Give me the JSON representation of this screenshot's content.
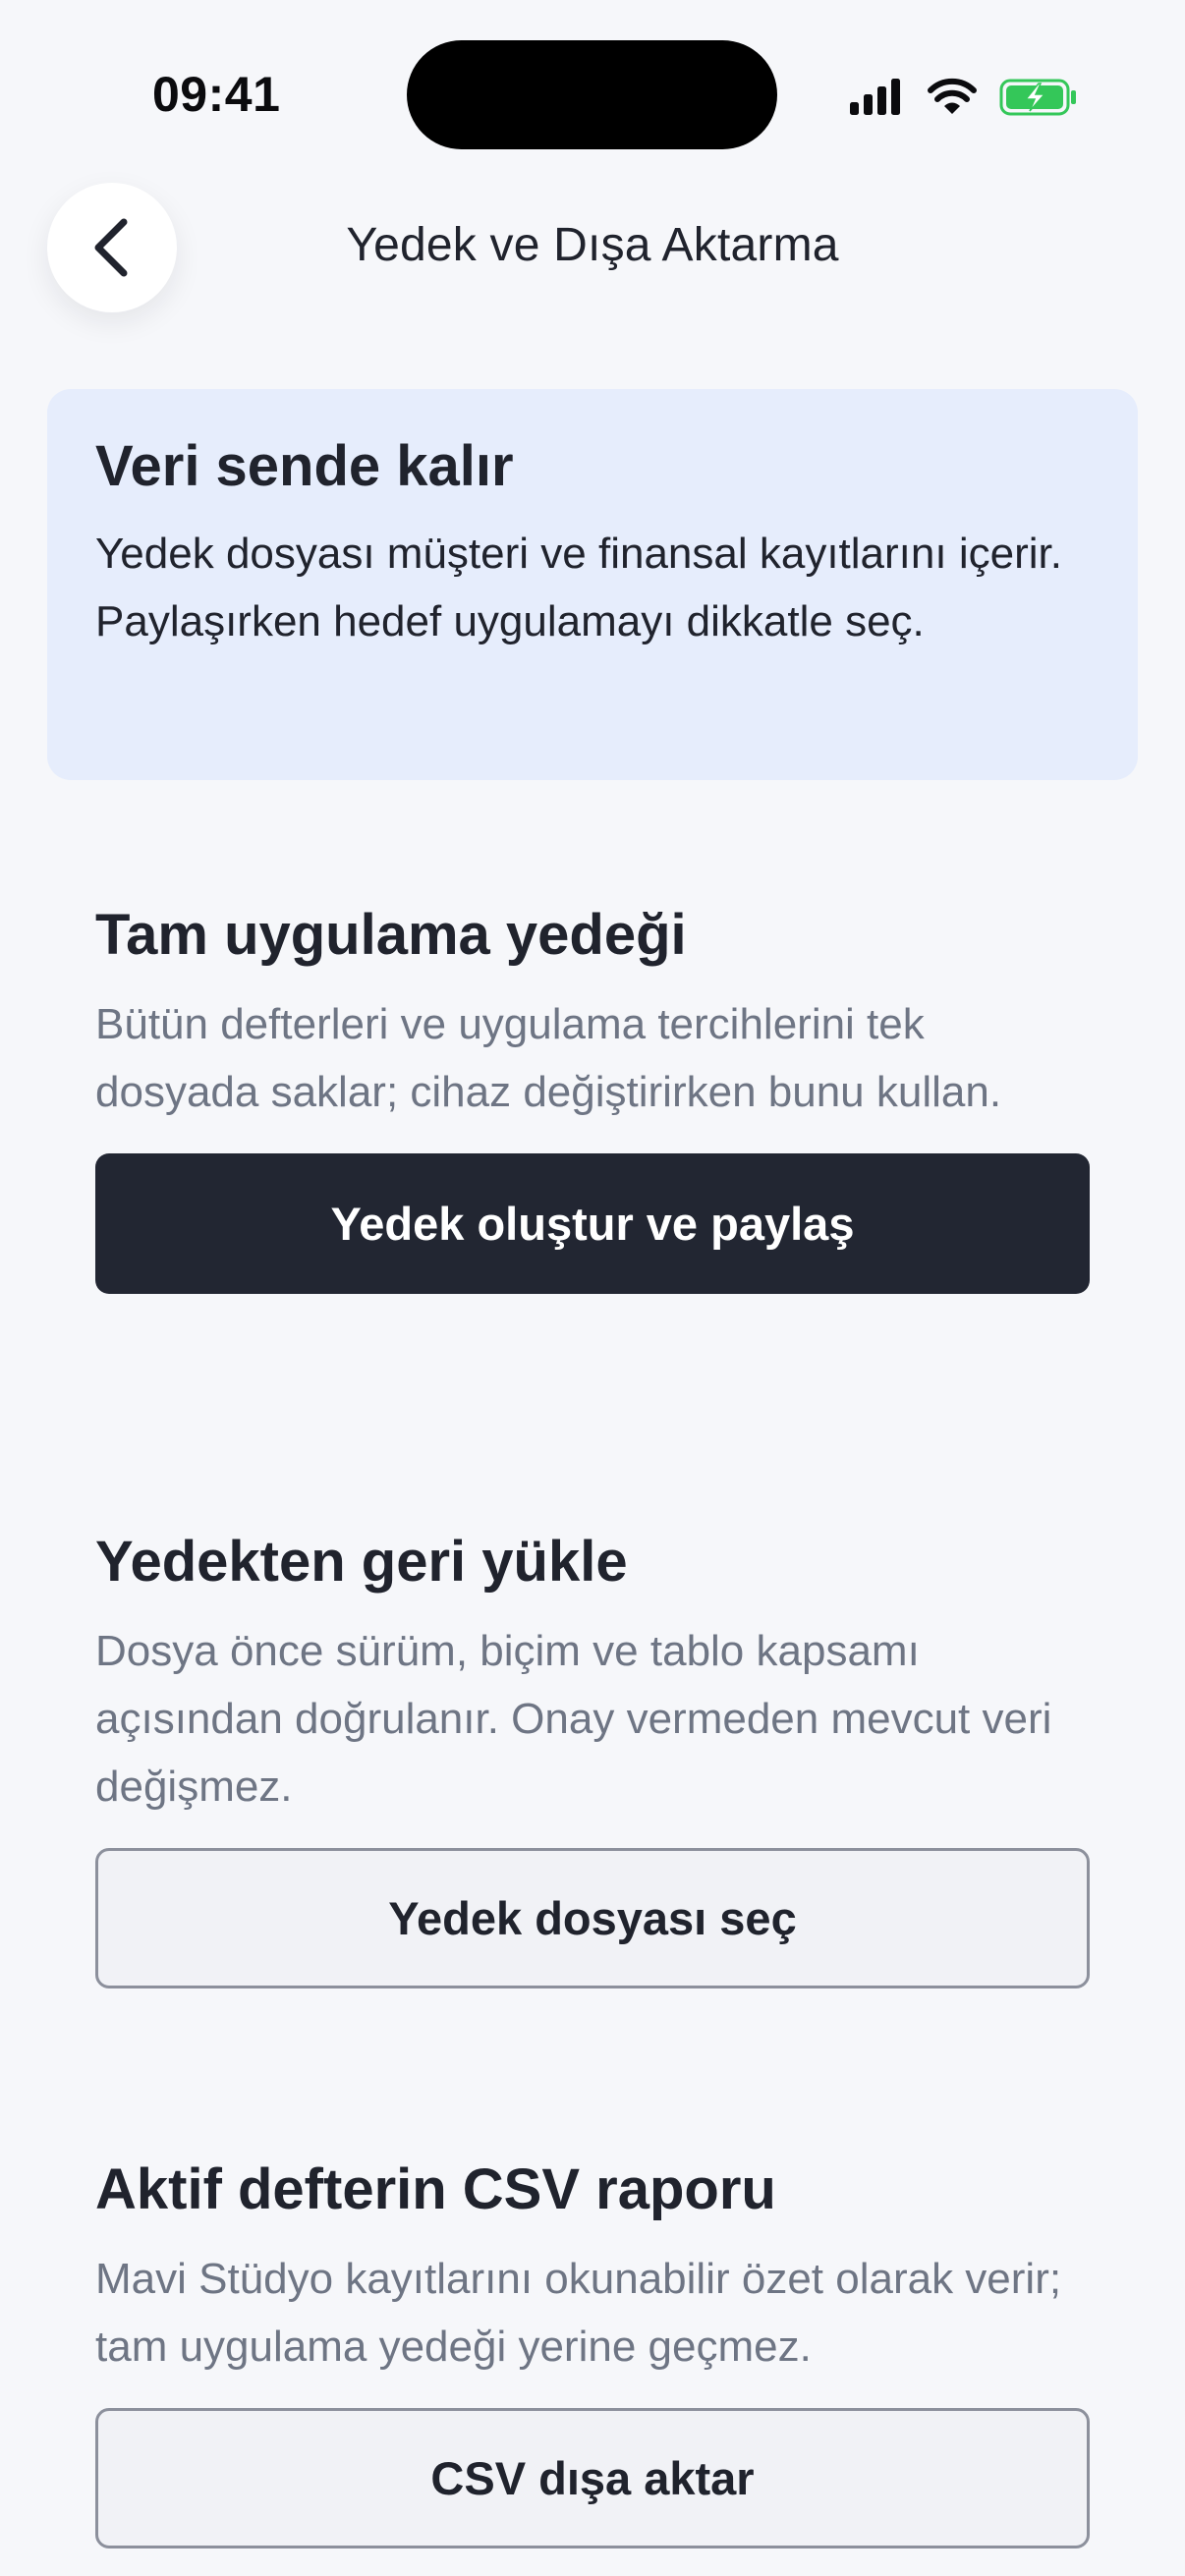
{
  "status_bar": {
    "time": "09:41",
    "icons": [
      "signal-icon",
      "wifi-icon",
      "battery-charging-icon"
    ],
    "battery_color": "#34c759"
  },
  "nav": {
    "title": "Yedek ve Dışa Aktarma",
    "back_icon": "chevron-left-icon"
  },
  "info_card": {
    "title": "Veri sende kalır",
    "body": "Yedek dosyası müşteri ve finansal kayıtlarını içerir. Paylaşırken hedef uygulamayı dikkatle seç.",
    "background": "#e6edfc"
  },
  "sections": [
    {
      "title": "Tam uygulama yedeği",
      "description": "Bütün defterleri ve uygulama tercihlerini tek dosyada saklar; cihaz değiştirirken bunu kullan.",
      "button_label": "Yedek oluştur ve paylaş"
    },
    {
      "title": "Yedekten geri yükle",
      "description": "Dosya önce sürüm, biçim ve tablo kapsamı açısından doğrulanır. Onay vermeden mevcut veri değişmez.",
      "button_label": "Yedek dosyası seç"
    },
    {
      "title": "Aktif defterin CSV raporu",
      "description": "Mavi Stüdyo kayıtlarını okunabilir özet olarak verir; tam uygulama yedeği yerine geçmez.",
      "button_label": "CSV dışa aktar"
    }
  ],
  "colors": {
    "background": "#f6f7fa",
    "primary_button": "#222632",
    "muted_text": "#6e7584"
  }
}
